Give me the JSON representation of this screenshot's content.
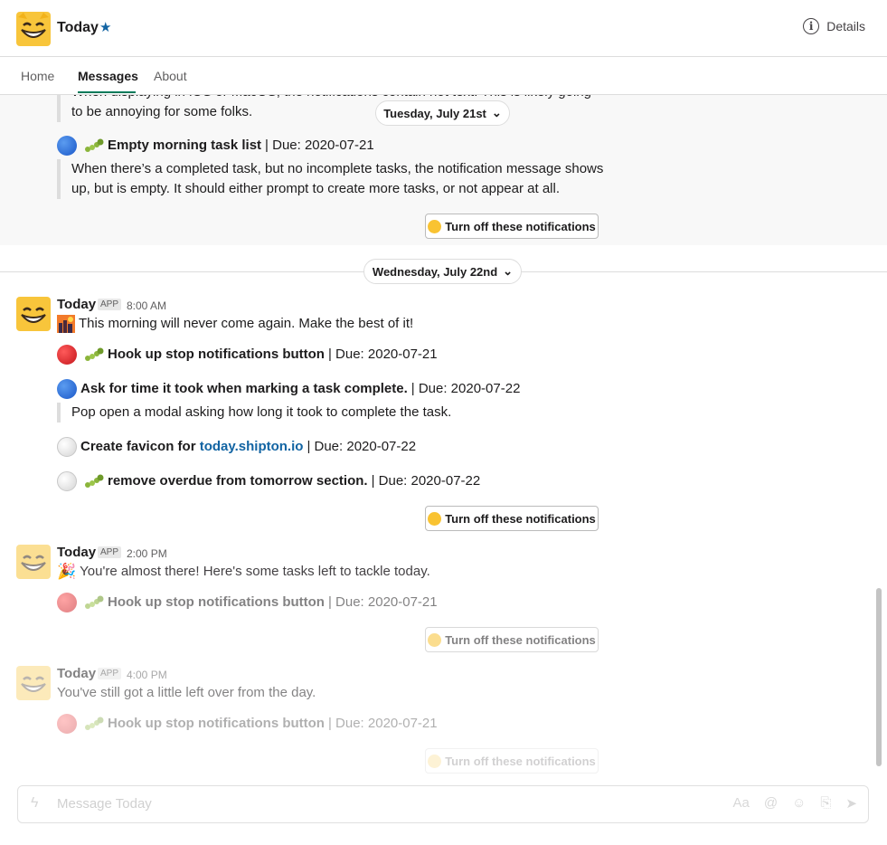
{
  "header": {
    "title": "Today",
    "details_label": "Details"
  },
  "tabs": [
    {
      "label": "Home"
    },
    {
      "label": "Messages"
    },
    {
      "label": "About"
    }
  ],
  "feed": {
    "partial_quote_top": "When displaying in iOS or MacOS, the notifications contain hot text. This is likely going",
    "partial_quote_bottom": "to be annoying for some folks.",
    "date_pill_1": "Tuesday, July 21st",
    "earlier_task": {
      "title": "Empty morning task list",
      "due": " | Due: 2020-07-21"
    },
    "earlier_task_desc_1": "When there’s a completed task, but no incomplete tasks, the notification message shows",
    "earlier_task_desc_2": "up, but is empty. It should either prompt to create more tasks, or not appear at all.",
    "turn_off_label": "Turn off these notifications",
    "date_pill_2": "Wednesday, July 22nd",
    "messages": [
      {
        "sender": "Today",
        "badge": "APP",
        "time": "8:00 AM",
        "text": "This morning will never come again. Make the best of it!",
        "tasks": [
          {
            "status": "red",
            "bug": true,
            "title": "Hook up stop notifications button",
            "due": " | Due: 2020-07-21"
          },
          {
            "status": "blue",
            "bug": false,
            "title": "Ask for time it took when marking a task complete.",
            "due": " | Due: 2020-07-22",
            "description": "Pop open a modal asking how long it took to complete the task."
          },
          {
            "status": "white",
            "bug": false,
            "title": "Create favicon for ",
            "link": "today.shipton.io",
            "due": " | Due: 2020-07-22"
          },
          {
            "status": "white",
            "bug": true,
            "title": "remove overdue from tomorrow section.",
            "due": " | Due: 2020-07-22"
          }
        ]
      },
      {
        "sender": "Today",
        "badge": "APP",
        "time": "2:00 PM",
        "text": "You're almost there! Here's some tasks left to tackle today.",
        "tasks": [
          {
            "status": "red",
            "bug": true,
            "title": "Hook up stop notifications button",
            "due": " | Due: 2020-07-21"
          }
        ]
      },
      {
        "sender": "Today",
        "badge": "APP",
        "time": "4:00 PM",
        "text": "You've still got a little left over from the day.",
        "tasks": [
          {
            "status": "red",
            "bug": true,
            "title": "Hook up stop notifications button",
            "due": " | Due: 2020-07-21"
          }
        ]
      }
    ]
  },
  "composer": {
    "placeholder": "Message Today"
  }
}
